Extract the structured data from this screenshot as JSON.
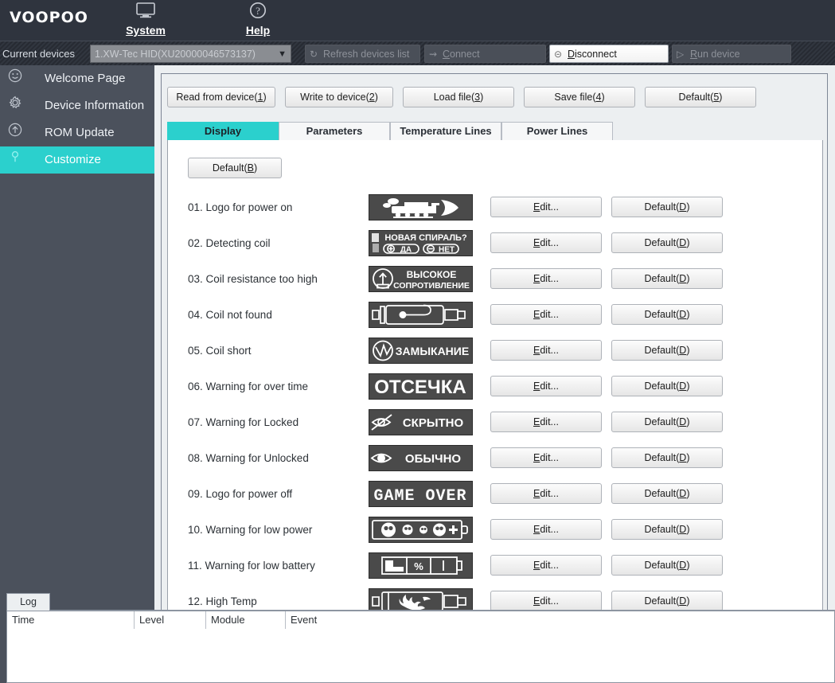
{
  "header": {
    "logo": "VOOPOO",
    "menu": [
      {
        "label": "System",
        "icon": "monitor-icon",
        "glyph": "Ὓ5"
      },
      {
        "label": "Help",
        "icon": "question-circle-icon",
        "glyph": "?"
      }
    ]
  },
  "devicebar": {
    "current_devices_label": "Current devices",
    "device_value": "1.XW-Tec HID(XU20000046573137)",
    "caret": "▼",
    "buttons": [
      {
        "label": "Refresh devices list",
        "icon": "refresh-icon",
        "enabled": false
      },
      {
        "label": "Connect",
        "icon": "plug-icon",
        "enabled": false
      },
      {
        "label": "Disconnect",
        "icon": "disconnect-icon",
        "enabled": true
      },
      {
        "label": "Run device",
        "icon": "play-icon",
        "enabled": false
      }
    ]
  },
  "sidebar": {
    "items": [
      {
        "label": "Welcome Page",
        "icon": "smiley-icon",
        "active": false
      },
      {
        "label": "Device Information",
        "icon": "gear-icon",
        "active": false
      },
      {
        "label": "ROM Update",
        "icon": "arrow-up-circle-icon",
        "active": false
      },
      {
        "label": "Customize",
        "icon": "key-icon",
        "active": true
      }
    ]
  },
  "toolbar": {
    "buttons": [
      {
        "label": "Read from device(",
        "mnemonic": "1",
        "suffix": ")"
      },
      {
        "label": "Write to device(",
        "mnemonic": "2",
        "suffix": ")"
      },
      {
        "label": "Load file(",
        "mnemonic": "3",
        "suffix": ")"
      },
      {
        "label": "Save file(",
        "mnemonic": "4",
        "suffix": ")"
      },
      {
        "label": "Default(",
        "mnemonic": "5",
        "suffix": ")"
      }
    ]
  },
  "tabs": [
    {
      "label": "Display",
      "selected": true
    },
    {
      "label": "Parameters",
      "selected": false
    },
    {
      "label": "Temperature Lines",
      "selected": false
    },
    {
      "label": "Power Lines",
      "selected": false
    }
  ],
  "display_pane": {
    "default_button": {
      "label": "Default(",
      "mnemonic": "B",
      "suffix": ")"
    },
    "row_edit_label": "dit...",
    "row_edit_mnemonic": "E",
    "row_default_label": "Default(",
    "row_default_mnemonic": "D",
    "row_default_suffix": ")",
    "rows": [
      {
        "label": "01. Logo for power on",
        "image": "locomotive-train-bitmap",
        "image_text": ""
      },
      {
        "label": "02. Detecting coil",
        "image": "new-coil-prompt-bitmap",
        "image_text": "НОВАЯ СПИРАЛЬ?"
      },
      {
        "label": "03. Coil resistance too high",
        "image": "high-resistance-bitmap",
        "image_text": "ВЫСОКОЕ"
      },
      {
        "label": "04. Coil not found",
        "image": "coil-not-found-bitmap",
        "image_text": ""
      },
      {
        "label": "05. Coil short",
        "image": "short-circuit-bitmap",
        "image_text": "ЗАМЫКАНИЕ"
      },
      {
        "label": "06. Warning for over time",
        "image": "cutoff-bitmap",
        "image_text": "ОТСЕЧКА"
      },
      {
        "label": "07. Warning for Locked",
        "image": "hidden-eye-bitmap",
        "image_text": "СКРЫТНО"
      },
      {
        "label": "08. Warning for Unlocked",
        "image": "visible-eye-bitmap",
        "image_text": "ОБЫЧНО"
      },
      {
        "label": "09. Logo for power off",
        "image": "game-over-bitmap",
        "image_text": "GAME OVER"
      },
      {
        "label": "10. Warning for low power",
        "image": "low-power-skulls-bitmap",
        "image_text": ""
      },
      {
        "label": "11. Warning for low battery",
        "image": "low-battery-percent-bitmap",
        "image_text": "%"
      },
      {
        "label": "12. High Temp",
        "image": "high-temp-flame-bitmap",
        "image_text": ""
      }
    ]
  },
  "log": {
    "tab_label": "Log",
    "columns": [
      "Time",
      "Level",
      "Module",
      "Event"
    ]
  },
  "colors": {
    "accent": "#2bd0cd",
    "header_bg": "#2f343e",
    "sidebar_bg": "#4b515c",
    "panel_bg": "#eceff1",
    "preview_bg": "#4a4a4a"
  }
}
